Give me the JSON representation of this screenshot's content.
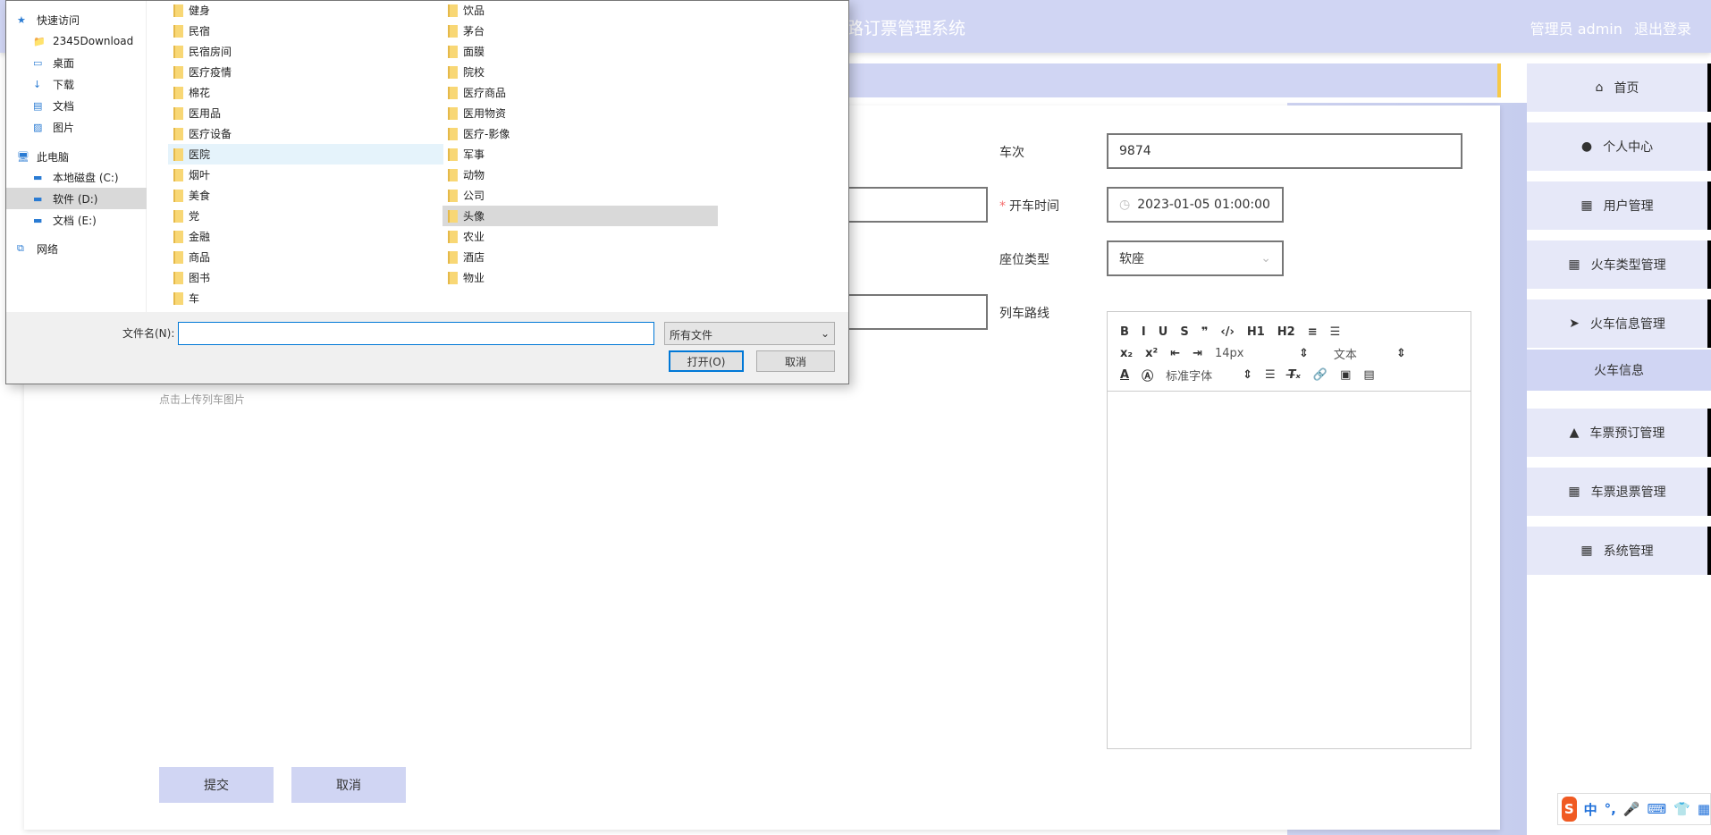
{
  "header": {
    "title": "铁路订票管理系统",
    "user_label": "管理员 admin",
    "logout": "退出登录"
  },
  "form": {
    "train_no_label": "车次",
    "train_no_value": "9874",
    "depart_label": "开车时间",
    "depart_value": "2023-01-05 01:00:00",
    "seat_label": "座位类型",
    "seat_value": "软座",
    "route_label": "列车路线",
    "upload_hint": "点击上传列车图片",
    "submit": "提交",
    "cancel": "取消"
  },
  "editor": {
    "row1": [
      "B",
      "I",
      "U",
      "S",
      "❞",
      "‹/›",
      "H1",
      "H2",
      "≡",
      "☰"
    ],
    "size": "14px",
    "text_type": "文本",
    "font": "标准字体"
  },
  "sidebar": {
    "items": [
      {
        "label": "首页",
        "icon": "⌂"
      },
      {
        "label": "个人中心",
        "icon": "●"
      },
      {
        "label": "用户管理",
        "icon": "▦"
      },
      {
        "label": "火车类型管理",
        "icon": "▦"
      },
      {
        "label": "火车信息管理",
        "icon": "➤"
      },
      {
        "label": "火车信息",
        "icon": ""
      },
      {
        "label": "车票预订管理",
        "icon": "▲"
      },
      {
        "label": "车票退票管理",
        "icon": "▦"
      },
      {
        "label": "系统管理",
        "icon": "▦"
      }
    ]
  },
  "dialog": {
    "nav": [
      {
        "label": "快速访问",
        "icon": "★"
      },
      {
        "label": "2345Download",
        "icon": "📁"
      },
      {
        "label": "桌面",
        "icon": "▭"
      },
      {
        "label": "下载",
        "icon": "↓"
      },
      {
        "label": "文档",
        "icon": "▤"
      },
      {
        "label": "图片",
        "icon": "▨"
      },
      {
        "label": "此电脑",
        "icon": "🖥"
      },
      {
        "label": "本地磁盘 (C:)",
        "icon": "▬"
      },
      {
        "label": "软件 (D:)",
        "icon": "▬"
      },
      {
        "label": "文档 (E:)",
        "icon": "▬"
      },
      {
        "label": "网络",
        "icon": "⧉"
      }
    ],
    "col1": [
      "健身",
      "民宿",
      "民宿房间",
      "医疗疫情",
      "棉花",
      "医用品",
      "医疗设备",
      "医院",
      "烟叶",
      "美食",
      "党",
      "金融",
      "商品",
      "图书",
      "车"
    ],
    "col2": [
      "饮品",
      "茅台",
      "面膜",
      "院校",
      "医疗商品",
      "医用物资",
      "医疗-影像",
      "军事",
      "动物",
      "公司",
      "头像",
      "农业",
      "酒店",
      "物业"
    ],
    "filename_label": "文件名(N):",
    "filename_value": "",
    "filter": "所有文件",
    "open": "打开(O)",
    "cancel": "取消"
  },
  "ime": {
    "items": [
      "中",
      "°,",
      "🎤",
      "⌨",
      "👕",
      "▦"
    ]
  }
}
